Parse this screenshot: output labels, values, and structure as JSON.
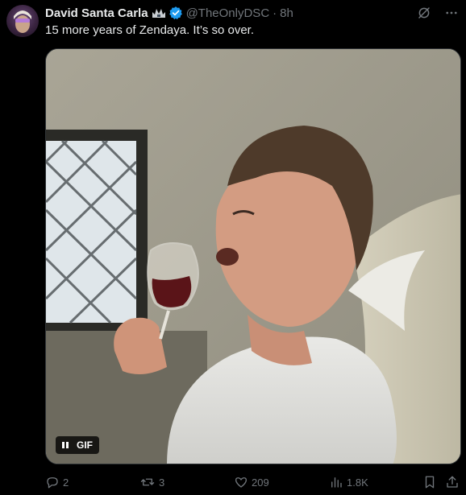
{
  "tweet": {
    "display_name": "David Santa Carla",
    "handle": "@TheOnlyDSC",
    "separator": "·",
    "time": "8h",
    "text": "15 more years of Zendaya. It’s so over.",
    "media": {
      "type": "gif",
      "badge_label": "GIF"
    },
    "actions": {
      "replies": "2",
      "reposts": "3",
      "likes": "209",
      "views": "1.8K"
    }
  },
  "colors": {
    "background": "#000000",
    "text_primary": "#e7e9ea",
    "text_secondary": "#71767b",
    "verified": "#1d9bf0"
  },
  "icons": [
    "grok-icon",
    "more-icon",
    "verified-icon",
    "affiliate-badge-icon",
    "reply-icon",
    "repost-icon",
    "like-icon",
    "views-icon",
    "bookmark-icon",
    "share-icon",
    "pause-icon"
  ]
}
